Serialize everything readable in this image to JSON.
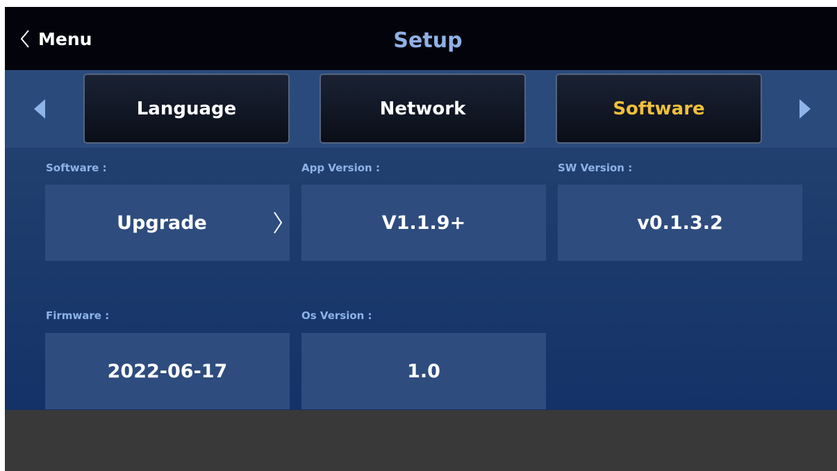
{
  "header": {
    "back_label": "Menu",
    "title": "Setup"
  },
  "tabs": [
    {
      "label": "Language",
      "active": false
    },
    {
      "label": "Network",
      "active": false
    },
    {
      "label": "Software",
      "active": true
    }
  ],
  "fields": {
    "software": {
      "label": "Software :",
      "value": "Upgrade"
    },
    "app_version": {
      "label": "App Version :",
      "value": "V1.1.9+"
    },
    "sw_version": {
      "label": "SW Version :",
      "value": "v0.1.3.2"
    },
    "firmware": {
      "label": "Firmware :",
      "value": "2022-06-17"
    },
    "os_version": {
      "label": "Os Version :",
      "value": "1.0"
    }
  },
  "colors": {
    "header_bg": "#03040b",
    "title": "#8fb1e6",
    "tabbar_bg": "#2a4a7c",
    "active_tab_text": "#f0bf3a",
    "content_bg": "#1b3a6b",
    "field_bg": "#2e4c7e",
    "field_label": "#8db3e8",
    "footer_bg": "#393939"
  },
  "icons": {
    "back": "chevron-left-icon",
    "prev": "triangle-left-icon",
    "next": "triangle-right-icon",
    "upgrade": "chevron-right-icon"
  }
}
